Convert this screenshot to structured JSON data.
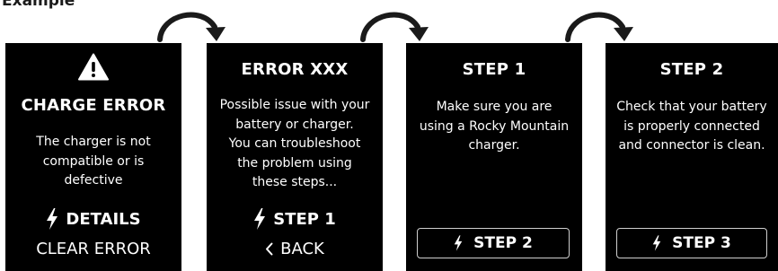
{
  "heading": "Example",
  "screens": [
    {
      "title": "CHARGE ERROR",
      "icon": "warning-icon",
      "lines": [
        "The charger is not",
        "compatible or is",
        "defective"
      ],
      "primary_action": "DETAILS",
      "secondary_action": "CLEAR ERROR"
    },
    {
      "title": "ERROR XXX",
      "lines": [
        "Possible issue with your",
        "battery or charger.",
        "You can troubleshoot",
        "the problem using",
        "these steps..."
      ],
      "primary_action": "STEP 1",
      "secondary_action": "BACK"
    },
    {
      "title": "STEP 1",
      "lines": [
        "Make sure you are",
        "using a Rocky Mountain",
        "charger."
      ],
      "button": "STEP 2"
    },
    {
      "title": "STEP 2",
      "lines": [
        "Check that your battery",
        "is properly connected",
        "and connector is clean."
      ],
      "button": "STEP 3"
    }
  ],
  "colors": {
    "screen_background": "#000000",
    "screen_text": "#ffffff",
    "arrow": "#1a1a1a",
    "button_border": "#cfcfcf"
  }
}
